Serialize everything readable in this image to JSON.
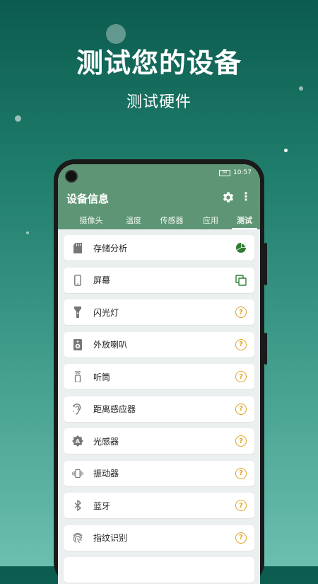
{
  "promo": {
    "headline": "测试您的设备",
    "subline": "测试硬件"
  },
  "status_bar": {
    "battery": "89",
    "time": "10:57"
  },
  "app_bar": {
    "title": "设备信息",
    "settings_icon": "gear-icon",
    "more_icon": "more-vert-icon"
  },
  "tabs": [
    {
      "label": "摄像头"
    },
    {
      "label": "温度"
    },
    {
      "label": "传感器"
    },
    {
      "label": "应用"
    },
    {
      "label": "测试",
      "active": true
    }
  ],
  "tests": [
    {
      "label": "存储分析",
      "icon": "sd-card-icon",
      "status_icon": "pie-chart-icon"
    },
    {
      "label": "屏幕",
      "icon": "phone-icon",
      "status_icon": "copy-icon"
    },
    {
      "label": "闪光灯",
      "icon": "flashlight-icon",
      "status_icon": "question-icon"
    },
    {
      "label": "外放喇叭",
      "icon": "speaker-icon",
      "status_icon": "question-icon"
    },
    {
      "label": "听筒",
      "icon": "earpiece-icon",
      "status_icon": "question-icon"
    },
    {
      "label": "距离感应器",
      "icon": "ear-icon",
      "status_icon": "question-icon"
    },
    {
      "label": "光感器",
      "icon": "brightness-auto-icon",
      "status_icon": "question-icon"
    },
    {
      "label": "振动器",
      "icon": "vibration-icon",
      "status_icon": "question-icon"
    },
    {
      "label": "蓝牙",
      "icon": "bluetooth-icon",
      "status_icon": "question-icon"
    },
    {
      "label": "指纹识别",
      "icon": "fingerprint-icon",
      "status_icon": "question-icon"
    }
  ],
  "colors": {
    "accent": "#5e9675",
    "question": "#e3a321",
    "chart": "#2e7d32"
  }
}
